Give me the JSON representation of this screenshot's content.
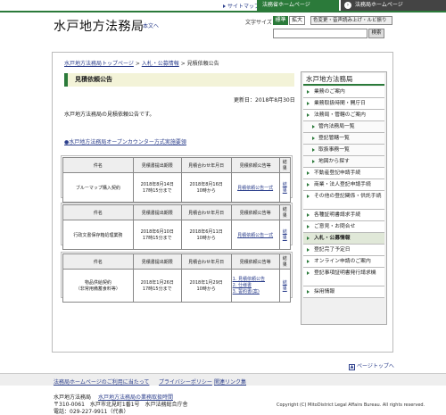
{
  "topbar": {
    "sitemap": "サイトマップ",
    "hp1": "法務省ホームページ",
    "hp2": "法務局ホームページ"
  },
  "header": {
    "logo": "水戸地方法務局",
    "honbun": "本文へ",
    "moji_size": "文字サイズ",
    "std": "標準",
    "big": "拡大",
    "color_btn": "色変更・音声読み上げ・ルビ振り",
    "search_btn": "検索",
    "search_placeholder": ""
  },
  "breadcrumb": {
    "home": "水戸地方法務局トップページ",
    "sep1": ">",
    "cat": "入札・公募情報",
    "sep2": ">",
    "current": "見積依頼公告"
  },
  "main": {
    "title": "見積依頼公告",
    "updated": "更新日：2018年8月30日",
    "intro": "水戸地方法務局の見積依頼公告です。",
    "link": "●水戸地方法務局オープンカウンター方式実施要領"
  },
  "table_headers": [
    "件名",
    "見積書提出期限",
    "見積合わせ年月日",
    "見積依頼公告等",
    "結果"
  ],
  "tables": [
    {
      "name": "ブルーマップ購入契約",
      "deadline": "2018年8月14日\n17時15分まで",
      "date": "2018年8月16日\n10時から",
      "notice": "見積依頼公告一式",
      "result": "結果"
    },
    {
      "name": "行政文書保存箱処理業務",
      "deadline": "2018年6月10日\n17時15分まで",
      "date": "2018年6月11日\n10時から",
      "notice": "見積依頼公告一式",
      "result": "結果"
    },
    {
      "name": "物品供給契約\n（非常用備蓄食料等）",
      "deadline": "2018年1月26日\n17時15分まで",
      "date": "2018年1月29日\n10時から",
      "notice": [
        "1. 見積依頼公告",
        "2. 仕様書",
        "3. 誓約書(案)"
      ],
      "result": "結果"
    }
  ],
  "sidebar": {
    "title": "水戸地方法務局",
    "items": [
      {
        "label": "業務のご案内",
        "sub": false
      },
      {
        "label": "業務取扱時間・開庁日",
        "sub": false
      },
      {
        "label": "法務局・管轄のご案内",
        "sub": false
      },
      {
        "label": "管内法務局一覧",
        "sub": true
      },
      {
        "label": "登記管轄一覧",
        "sub": true
      },
      {
        "label": "取扱事務一覧",
        "sub": true
      },
      {
        "label": "地図から探す",
        "sub": true
      },
      {
        "label": "不動産登記申請手続",
        "sub": false
      },
      {
        "label": "商業・法人登記申請手続",
        "sub": false
      },
      {
        "label": "その他の登記関係・供託手続",
        "sub": false,
        "tall": true
      },
      {
        "label": "各種証明書請求手続",
        "sub": false
      },
      {
        "label": "ご意見・お問合せ",
        "sub": false
      },
      {
        "label": "入札・公募情報",
        "sub": false,
        "active": true
      },
      {
        "label": "登記完了予定日",
        "sub": false
      },
      {
        "label": "オンライン申請のご案内",
        "sub": false
      },
      {
        "label": "登記事項証明書発行請求機",
        "sub": false,
        "tall": true
      },
      {
        "label": "採用情報",
        "sub": false
      }
    ]
  },
  "pagetop": "ページトップへ",
  "footer": {
    "nav": [
      "法務局ホームページのご利用に当たって",
      "プライバシーポリシー",
      "関連リンク集"
    ],
    "name": "水戸地方法務局",
    "link": "水戸地方法務局の業務取扱時間",
    "addr": "〒310-0061　水戸市北見町1番1号　水戸法務総合庁舎",
    "tel": "電話：029-227-9911（代表）",
    "copyright": "Copyright (C) MitoDistrict Legal Affairs Bureau. All rights reserved."
  }
}
